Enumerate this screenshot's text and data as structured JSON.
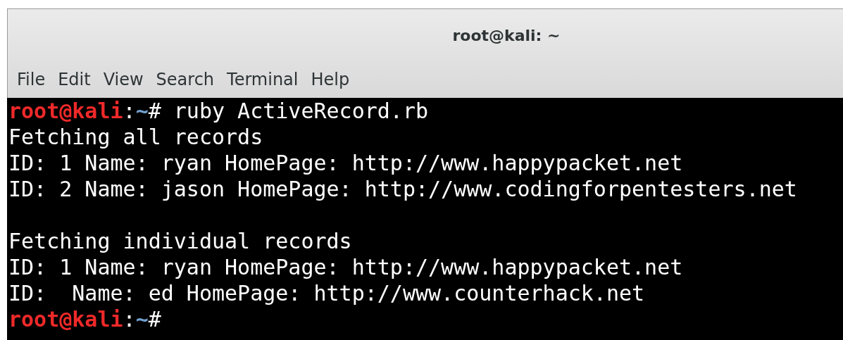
{
  "window": {
    "title": "root@kali: ~"
  },
  "menu": [
    "File",
    "Edit",
    "View",
    "Search",
    "Terminal",
    "Help"
  ],
  "terminal": {
    "lines": [
      {
        "kind": "prompt",
        "user_host": "root@kali",
        "separator": ":",
        "path": "~",
        "symbol": "#",
        "command": " ruby ActiveRecord.rb"
      },
      {
        "kind": "output",
        "text": "Fetching all records"
      },
      {
        "kind": "output",
        "text": "ID: 1 Name: ryan HomePage: http://www.happypacket.net"
      },
      {
        "kind": "output",
        "text": "ID: 2 Name: jason HomePage: http://www.codingforpentesters.net"
      },
      {
        "kind": "blank"
      },
      {
        "kind": "output",
        "text": "Fetching individual records"
      },
      {
        "kind": "output",
        "text": "ID: 1 Name: ryan HomePage: http://www.happypacket.net"
      },
      {
        "kind": "output",
        "text": "ID:  Name: ed HomePage: http://www.counterhack.net"
      },
      {
        "kind": "prompt",
        "user_host": "root@kali",
        "separator": ":",
        "path": "~",
        "symbol": "#"
      }
    ]
  }
}
